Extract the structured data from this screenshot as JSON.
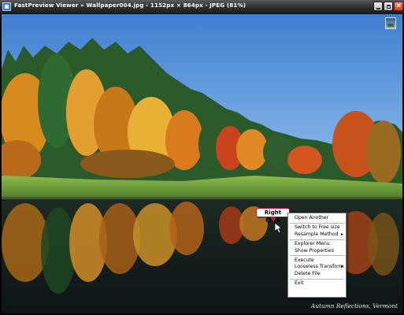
{
  "window": {
    "title": "FastPreview Viewer » Wallpaper004.jpg - 1152px × 864px - JPEG (81%)",
    "controls": [
      "minimize",
      "maximize",
      "close"
    ]
  },
  "image": {
    "caption": "Autumn Reflections, Vermont"
  },
  "callout": {
    "label": "Right Click"
  },
  "context_menu": {
    "groups": [
      [
        {
          "label": "Open Another",
          "submenu": false
        }
      ],
      [
        {
          "label": "Switch to Free size",
          "submenu": false
        },
        {
          "label": "Resample Method",
          "submenu": true
        }
      ],
      [
        {
          "label": "Explorer Menu",
          "submenu": false
        },
        {
          "label": "Show Properties",
          "submenu": false
        }
      ],
      [
        {
          "label": "Execute",
          "submenu": false
        },
        {
          "label": "Looseless Transform",
          "submenu": true
        },
        {
          "label": "Delete File",
          "submenu": false
        }
      ],
      [
        {
          "label": "Exit",
          "submenu": false
        }
      ]
    ]
  },
  "icons": {
    "app": "app-icon",
    "thumbnail": "thumbnail-toggle-icon",
    "cursor": "mouse-pointer-icon"
  }
}
